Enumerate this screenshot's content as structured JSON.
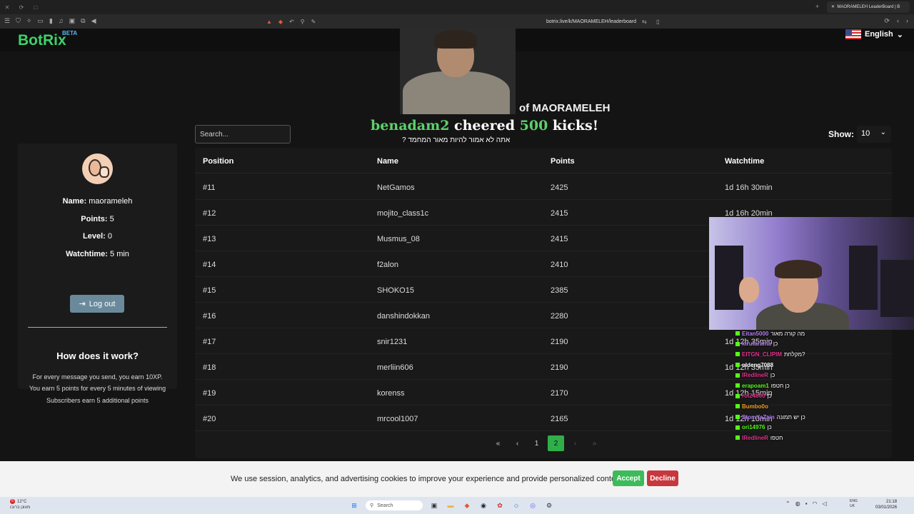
{
  "browser": {
    "tab_title": "MAORAMELEH LeaderBoard | B",
    "url": "botrix.live/k/MAORAMELEH/leaderboard"
  },
  "site": {
    "logo": "BotRix",
    "beta": "BETA",
    "language": "English"
  },
  "heading": "of MAORAMELEH",
  "overlay": {
    "cheer_user": "benadam2",
    "cheer_word": "cheered",
    "cheer_amount": "500",
    "cheer_unit": "kicks!",
    "cheer_message": "? אתה לא אמור להיות מאור המחמד"
  },
  "search": {
    "placeholder": "Search..."
  },
  "show": {
    "label": "Show:",
    "value": "10"
  },
  "profile": {
    "name_label": "Name:",
    "name": "maorameleh",
    "points_label": "Points:",
    "points": "5",
    "level_label": "Level:",
    "level": "0",
    "watchtime_label": "Watchtime:",
    "watchtime": "5 min",
    "logout": "Log out",
    "how_title": "How does it work?",
    "how_lines": [
      "For every message you send, you earn 10XP.",
      "You earn 5 points for every 5 minutes of viewing",
      "Subscribers earn 5 additional points"
    ]
  },
  "table": {
    "headers": [
      "Position",
      "Name",
      "Points",
      "Watchtime"
    ],
    "rows": [
      [
        "#11",
        "NetGamos",
        "2425",
        "1d 16h 30min"
      ],
      [
        "#12",
        "mojito_class1c",
        "2415",
        "1d 16h 20min"
      ],
      [
        "#13",
        "Musmus_08",
        "2415",
        ""
      ],
      [
        "#14",
        "f2alon",
        "2410",
        ""
      ],
      [
        "#15",
        "SHOKO15",
        "2385",
        ""
      ],
      [
        "#16",
        "danshindokkan",
        "2280",
        ""
      ],
      [
        "#17",
        "snir1231",
        "2190",
        "1d 12h 35min"
      ],
      [
        "#18",
        "merliin606",
        "2190",
        "1d 12h 35min"
      ],
      [
        "#19",
        "korenss",
        "2170",
        "1d 12h 15min"
      ],
      [
        "#20",
        "mrcool1007",
        "2165",
        "1d 12h 10min"
      ]
    ]
  },
  "pagination": {
    "first": "«",
    "prev": "‹",
    "pages": [
      "1",
      "2"
    ],
    "active": "2",
    "next": "›",
    "last": "»"
  },
  "chat": [
    {
      "user": "Eitan5000",
      "text": "מה קורה מאור",
      "color": "#b37ff0"
    },
    {
      "user": "kirutarama",
      "text": "כן",
      "color": "#b37ff0"
    },
    {
      "user": "EITGN_CLIPIM",
      "text": "מקלחת?",
      "color": "#e0338a"
    },
    {
      "user": "oldeng7088",
      "text": "",
      "color": "#ffffff"
    },
    {
      "user": "lRedlineR",
      "text": "כן",
      "color": "#e0338a"
    },
    {
      "user": "erapoam1",
      "text": "כן חטפו",
      "color": "#53fc18"
    },
    {
      "user": "roi24800",
      "text": "כן",
      "color": "#e0338a"
    },
    {
      "user": "Bumbo0o",
      "text": "",
      "color": "#f0a028"
    },
    {
      "user": "StomYaZain",
      "text": "כן יש תמונה",
      "color": "#b37ff0"
    },
    {
      "user": "ori14976",
      "text": "כן",
      "color": "#53fc18"
    },
    {
      "user": "lRedlineR",
      "text": "חטפו",
      "color": "#e0338a"
    }
  ],
  "cookie": {
    "text": "We use session, analytics, and advertising cookies to improve your experience and provide personalized content.",
    "accept": "Accept",
    "decline": "Decline"
  },
  "taskbar": {
    "weather_temp": "12°C",
    "weather_desc": "מעונן ברובו",
    "notification_count": "6",
    "search": "Search",
    "lang": "ENG",
    "region": "UK",
    "time": "21:18",
    "date": "03/01/2026"
  },
  "colors": {
    "brand_green": "#3fd16b",
    "accent_green": "#2fae4a",
    "accept": "#3dbb5a",
    "decline": "#c8373d"
  }
}
